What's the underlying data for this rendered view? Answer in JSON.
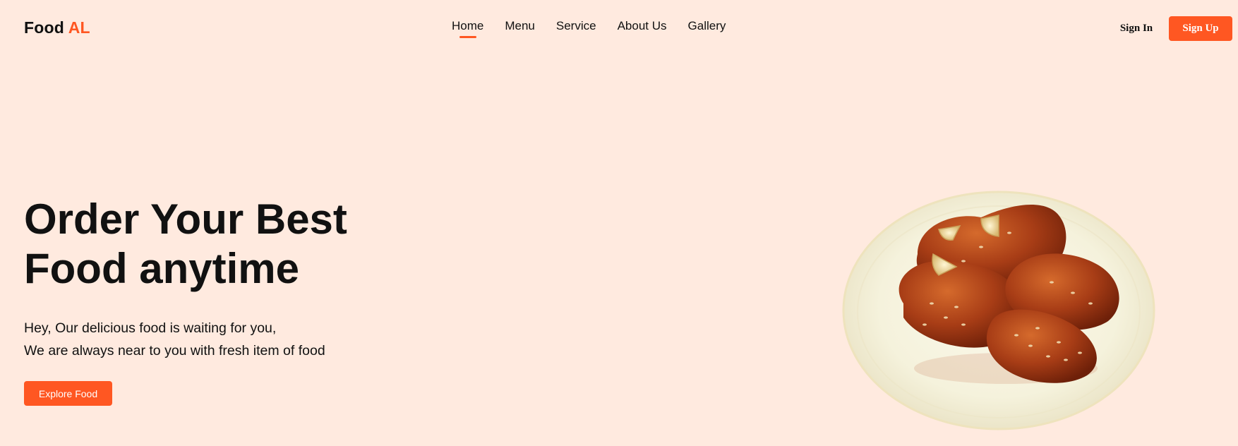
{
  "header": {
    "logo": {
      "main": "Food",
      "accent": "AL"
    },
    "nav": [
      {
        "label": "Home",
        "active": true
      },
      {
        "label": "Menu",
        "active": false
      },
      {
        "label": "Service",
        "active": false
      },
      {
        "label": "About Us",
        "active": false
      },
      {
        "label": "Gallery",
        "active": false
      }
    ],
    "sign_in_label": "Sign In",
    "sign_up_label": "Sign Up"
  },
  "hero": {
    "title_line1": "Order Your Best",
    "title_line2": "Food anytime",
    "subtitle_line1": "Hey, Our delicious food is waiting for you,",
    "subtitle_line2": "We are always near to you with fresh item of food",
    "cta_label": "Explore Food"
  },
  "colors": {
    "background": "#ffeadf",
    "accent": "#ff5722",
    "text": "#111111"
  }
}
